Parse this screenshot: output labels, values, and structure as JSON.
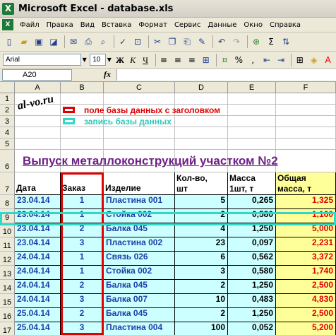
{
  "window": {
    "title": "Microsoft Excel - database.xls",
    "app_icon": "X"
  },
  "menu": [
    "Файл",
    "Правка",
    "Вид",
    "Вставка",
    "Формат",
    "Сервис",
    "Данные",
    "Окно",
    "Справка"
  ],
  "toolbar": {
    "font_name": "Arial",
    "font_size": "10",
    "bold": "Ж",
    "italic": "К",
    "underline": "Ч",
    "sigma": "Σ"
  },
  "formula_bar": {
    "cell_ref": "A20",
    "fx": "fx",
    "content": ""
  },
  "columns": [
    "A",
    "B",
    "C",
    "D",
    "E",
    "F"
  ],
  "rows": [
    "1",
    "2",
    "3",
    "4",
    "5",
    "6",
    "7",
    "8",
    "9",
    "10",
    "11",
    "12",
    "13",
    "14",
    "15",
    "16",
    "17"
  ],
  "watermark": "al-vo.ru",
  "legend": {
    "field_label": "поле базы данных с заголовком",
    "record_label": "запись базы данных",
    "field_color": "#e00000",
    "record_color": "#30d8c8"
  },
  "sheet_title": "Выпуск металлоконструкций участком №2",
  "headers": {
    "date": "Дата",
    "order": "Заказ",
    "item": "Изделие",
    "qty": [
      "Кол-во,",
      "шт"
    ],
    "mass": [
      "Масса",
      "1шт, т"
    ],
    "total": [
      "Общая",
      "масса, т"
    ]
  },
  "colors": {
    "data_fill": "#ccffff",
    "total_fill": "#ffff99",
    "blue_text": "#1f3ea8",
    "red_text": "#e00000",
    "title_color": "#6e1f86"
  },
  "records": [
    {
      "date": "23.04.14",
      "order": "1",
      "item": "Пластина 001",
      "qty": "5",
      "mass": "0,265",
      "total": "1,325"
    },
    {
      "date": "23.04.14",
      "order": "1",
      "item": "Стойка 002",
      "qty": "2",
      "mass": "0,580",
      "total": "1,160"
    },
    {
      "date": "23.04.14",
      "order": "2",
      "item": "Балка 045",
      "qty": "4",
      "mass": "1,250",
      "total": "5,000"
    },
    {
      "date": "23.04.14",
      "order": "3",
      "item": "Пластина 002",
      "qty": "23",
      "mass": "0,097",
      "total": "2,231"
    },
    {
      "date": "24.04.14",
      "order": "1",
      "item": "Связь 026",
      "qty": "6",
      "mass": "0,562",
      "total": "3,372"
    },
    {
      "date": "24.04.14",
      "order": "1",
      "item": "Стойка 002",
      "qty": "3",
      "mass": "0,580",
      "total": "1,740"
    },
    {
      "date": "24.04.14",
      "order": "2",
      "item": "Балка 045",
      "qty": "2",
      "mass": "1,250",
      "total": "2,500"
    },
    {
      "date": "24.04.14",
      "order": "3",
      "item": "Балка 007",
      "qty": "10",
      "mass": "0,483",
      "total": "4,830"
    },
    {
      "date": "25.04.14",
      "order": "2",
      "item": "Балка 045",
      "qty": "2",
      "mass": "1,250",
      "total": "2,500"
    },
    {
      "date": "25.04.14",
      "order": "3",
      "item": "Пластина 004",
      "qty": "100",
      "mass": "0,052",
      "total": "5,200"
    }
  ]
}
